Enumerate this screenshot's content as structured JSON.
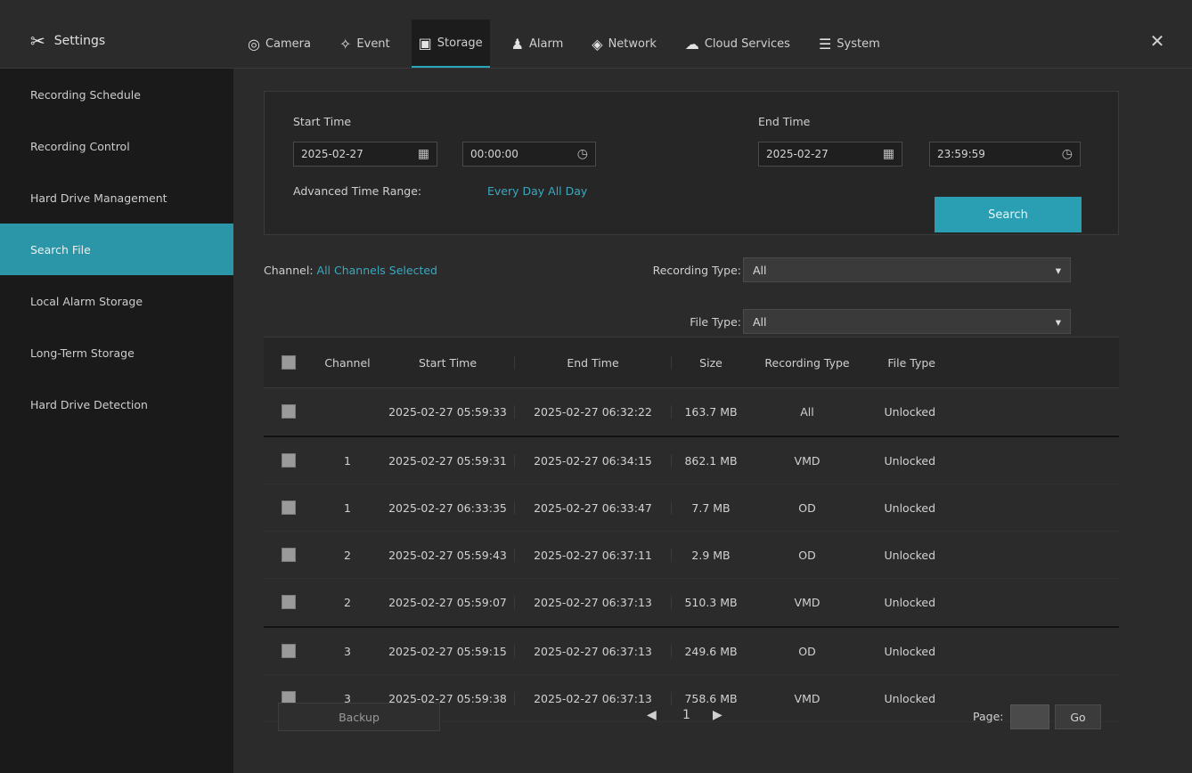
{
  "app": {
    "title": "Settings",
    "icon": "tools-icon"
  },
  "tabs": [
    {
      "label": "Camera",
      "icon": "camera-icon"
    },
    {
      "label": "Event",
      "icon": "event-icon"
    },
    {
      "label": "Storage",
      "icon": "storage-icon",
      "active": true
    },
    {
      "label": "Alarm",
      "icon": "bell-icon"
    },
    {
      "label": "Network",
      "icon": "network-icon"
    },
    {
      "label": "Cloud Services",
      "icon": "cloud-icon"
    },
    {
      "label": "System",
      "icon": "system-icon"
    }
  ],
  "sidebar": {
    "items": [
      {
        "label": "Recording Schedule"
      },
      {
        "label": "Recording Control"
      },
      {
        "label": "Hard Drive Management"
      },
      {
        "label": "Search File",
        "active": true
      },
      {
        "label": "Local Alarm Storage"
      },
      {
        "label": "Long-Term Storage"
      },
      {
        "label": "Hard Drive Detection"
      }
    ]
  },
  "search": {
    "start_label": "Start Time",
    "end_label": "End Time",
    "start_date": "2025-02-27",
    "start_time": "00:00:00",
    "end_date": "2025-02-27",
    "end_time": "23:59:59",
    "advanced_label": "Advanced Time Range:",
    "advanced_value": "Every Day All Day",
    "search_button": "Search"
  },
  "filters": {
    "channel_label": "Channel:",
    "channel_value": "All Channels Selected",
    "recording_type_label": "Recording Type:",
    "recording_type_value": "All",
    "file_type_label": "File Type:",
    "file_type_value": "All"
  },
  "table": {
    "headers": [
      "Channel",
      "Start Time",
      "End Time",
      "Size",
      "Recording Type",
      "File Type"
    ],
    "rows": [
      {
        "channel": "",
        "start": "2025-02-27 05:59:33",
        "end": "2025-02-27 06:32:22",
        "size": "163.7 MB",
        "rec_type": "All",
        "file_type": "Unlocked"
      },
      {
        "channel": "1",
        "start": "2025-02-27 05:59:31",
        "end": "2025-02-27 06:34:15",
        "size": "862.1 MB",
        "rec_type": "VMD",
        "file_type": "Unlocked"
      },
      {
        "channel": "1",
        "start": "2025-02-27 06:33:35",
        "end": "2025-02-27 06:33:47",
        "size": "7.7 MB",
        "rec_type": "OD",
        "file_type": "Unlocked"
      },
      {
        "channel": "2",
        "start": "2025-02-27 05:59:43",
        "end": "2025-02-27 06:37:11",
        "size": "2.9 MB",
        "rec_type": "OD",
        "file_type": "Unlocked"
      },
      {
        "channel": "2",
        "start": "2025-02-27 05:59:07",
        "end": "2025-02-27 06:37:13",
        "size": "510.3 MB",
        "rec_type": "VMD",
        "file_type": "Unlocked"
      },
      {
        "channel": "3",
        "start": "2025-02-27 05:59:15",
        "end": "2025-02-27 06:37:13",
        "size": "249.6 MB",
        "rec_type": "OD",
        "file_type": "Unlocked"
      },
      {
        "channel": "3",
        "start": "2025-02-27 05:59:38",
        "end": "2025-02-27 06:37:13",
        "size": "758.6 MB",
        "rec_type": "VMD",
        "file_type": "Unlocked"
      }
    ]
  },
  "footer": {
    "action_button": "Backup",
    "page_number": "1",
    "page_label": "Page:",
    "go_button": "Go"
  }
}
